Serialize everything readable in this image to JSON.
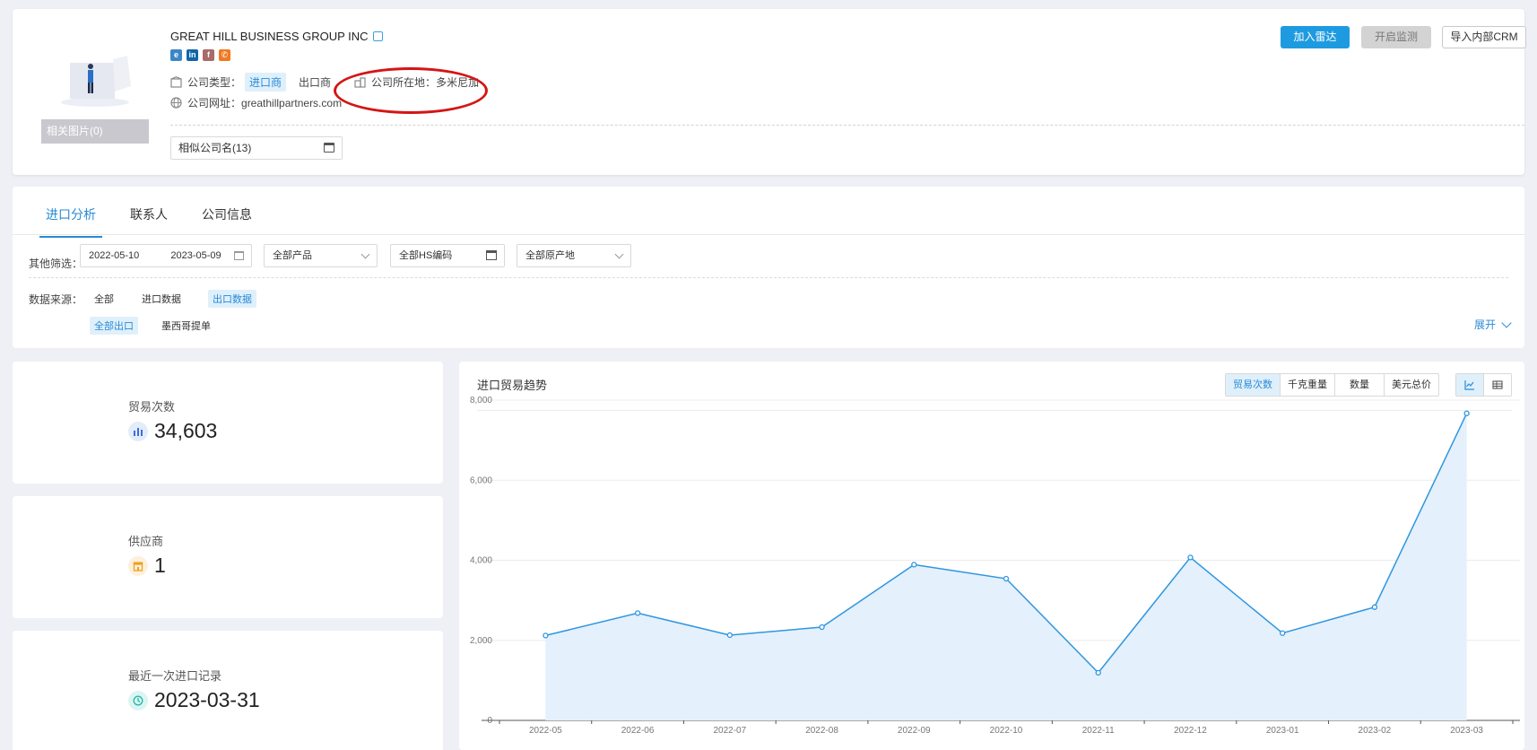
{
  "company": {
    "name": "GREAT HILL BUSINESS GROUP INC",
    "logo_caption": "相关图片(0)",
    "social": [
      "e",
      "in",
      "f",
      "phone"
    ],
    "type_label": "公司类型：",
    "type_tag": "进口商",
    "type_other": "出口商",
    "location_label": "公司所在地：",
    "location_value": "多米尼加",
    "website_label": "公司网址：",
    "website_value": "greathillpartners.com",
    "similar_label": "相似公司名(13)"
  },
  "actions": {
    "join_radar": "加入雷达",
    "start_monitor": "开启监测",
    "import_crm": "导入内部CRM"
  },
  "tabs": [
    {
      "label": "进口分析",
      "active": true
    },
    {
      "label": "联系人",
      "active": false
    },
    {
      "label": "公司信息",
      "active": false
    }
  ],
  "filters": {
    "label": "其他筛选：",
    "date_start": "2022-05-10",
    "date_end": "2023-05-09",
    "product": "全部产品",
    "hs_code": "全部HS编码",
    "origin": "全部原产地",
    "source_label": "数据来源：",
    "source_options": [
      "全部",
      "进口数据",
      "出口数据"
    ],
    "source_active": "出口数据",
    "sub_options": [
      "全部出口",
      "墨西哥提单"
    ],
    "sub_active": "全部出口",
    "expand": "展开"
  },
  "stats": [
    {
      "label": "贸易次数",
      "value": "34,603",
      "icon": "bar-chart-icon",
      "color": "#3b6fd8"
    },
    {
      "label": "供应商",
      "value": "1",
      "icon": "store-icon",
      "color": "#f0a020"
    },
    {
      "label": "最近一次进口记录",
      "value": "2023-03-31",
      "icon": "clock-icon",
      "color": "#22b8a8"
    }
  ],
  "chart": {
    "title": "进口贸易趋势",
    "metrics": [
      "贸易次数",
      "千克重量",
      "数量",
      "美元总价"
    ],
    "metric_active": "贸易次数",
    "views": [
      "line-view-icon",
      "table-view-icon"
    ],
    "view_active": "line-view-icon"
  },
  "chart_data": {
    "type": "area",
    "title": "进口贸易趋势",
    "categories": [
      "2022-05",
      "2022-06",
      "2022-07",
      "2022-08",
      "2022-09",
      "2022-10",
      "2022-11",
      "2022-12",
      "2023-01",
      "2023-02",
      "2023-03"
    ],
    "series": [
      {
        "values": [
          2120,
          2680,
          2130,
          2330,
          3890,
          3540,
          1190,
          4070,
          2180,
          2830,
          7670
        ]
      }
    ],
    "ylim": [
      0,
      8000
    ],
    "yticks": [
      "0",
      "2,000",
      "4,000",
      "6,000",
      "8,000"
    ],
    "grid": true,
    "line_color": "#2f96e0",
    "fill_color": "#e4f0fb"
  }
}
